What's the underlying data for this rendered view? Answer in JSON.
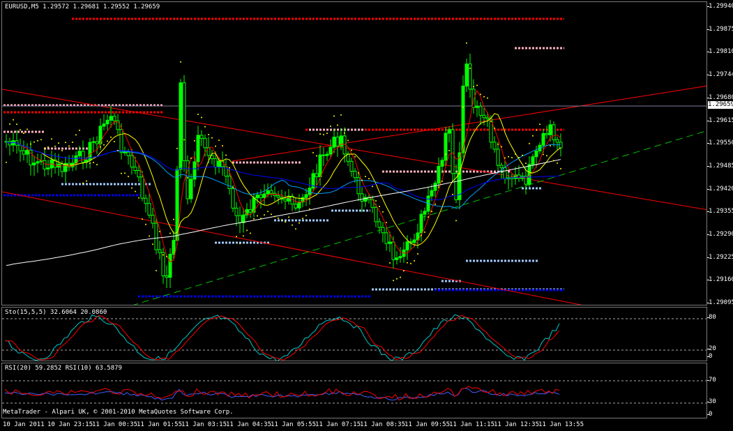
{
  "main_chart": {
    "symbol_label": "EURUSD,M5  1.29572 1.29681 1.29552 1.29659",
    "current_price": "1.29659",
    "price_labels": [
      "1.29940",
      "1.29875",
      "1.29810",
      "1.29744",
      "1.29680",
      "1.29615",
      "1.29550",
      "1.29485",
      "1.29420",
      "1.29355",
      "1.29290",
      "1.29225",
      "1.29160",
      "1.29095"
    ],
    "colors": {
      "candle": "#00ff00",
      "sma_fast": "#ff0000",
      "sma_mid": "#ffff00",
      "sma_slow": "#0000ff",
      "sma_long": "#ffffff",
      "trend_green": "#00c000",
      "trend_red": "#ff0000",
      "sar": "#ffff00",
      "level_red": "#ff0000",
      "level_pink": "#ffb0c0",
      "level_blue": "#0000ff",
      "level_lightblue": "#a0c8ff"
    }
  },
  "stochastic": {
    "label": "Sto(15,5,5) 32.6064 20.0860",
    "levels": [
      "80",
      "20",
      "0"
    ],
    "colors": {
      "main": "#00c8c8",
      "signal": "#ff0000"
    }
  },
  "rsi": {
    "label": "RSI(20) 59.2852  RSI(10) 63.5879",
    "levels": [
      "70",
      "30",
      "0"
    ],
    "colors": {
      "rsi20": "#4060ff",
      "rsi10": "#ff0000"
    }
  },
  "time_labels": [
    "10 Jan 2011",
    "10 Jan 23:15",
    "11 Jan 00:35",
    "11 Jan 01:55",
    "11 Jan 03:15",
    "11 Jan 04:35",
    "11 Jan 05:55",
    "11 Jan 07:15",
    "11 Jan 08:35",
    "11 Jan 09:55",
    "11 Jan 11:15",
    "11 Jan 12:35",
    "11 Jan 13:55"
  ],
  "footer": "MetaTrader - Alpari UK, © 2001-2010 MetaQuotes Software Corp."
}
